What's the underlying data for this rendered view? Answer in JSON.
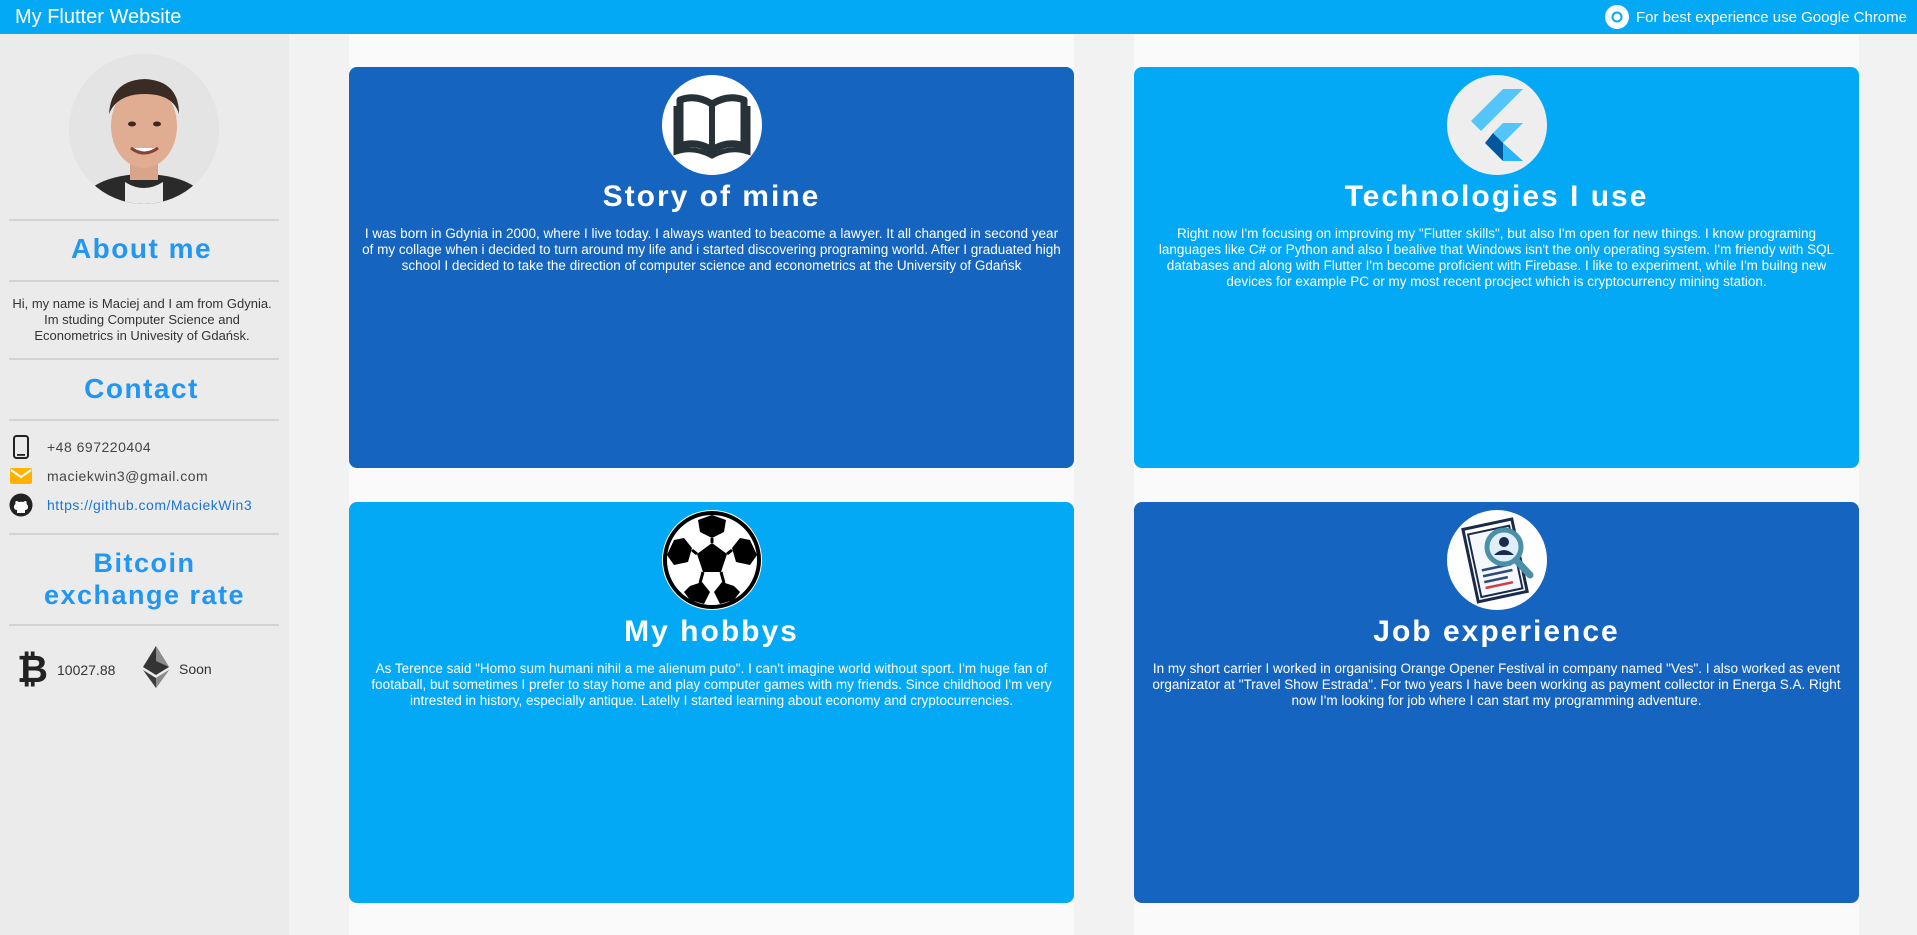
{
  "appbar": {
    "title": "My Flutter Website",
    "browser_hint": "For best experience use Google Chrome"
  },
  "sidebar": {
    "about_heading": "About me",
    "about_text": "Hi, my name is Maciej and I am from Gdynia. Im studing Computer Science and Econometrics in Univesity of Gdańsk.",
    "contact_heading": "Contact",
    "phone": "+48 697220404",
    "email": "maciekwin3@gmail.com",
    "github": "https://github.com/MaciekWin3",
    "bitcoin_heading_line1": "Bitcoin",
    "bitcoin_heading_line2": "exchange rate",
    "btc_rate": "10027.88",
    "eth_rate": "Soon"
  },
  "cards": {
    "story": {
      "title": "Story of mine",
      "text": "I was born in Gdynia in 2000, where I live today. I always wanted to beacome a lawyer. It all changed in second year of my collage when i decided to turn around my life and i started discovering programing world. After I graduated high school I decided to take the direction of computer science and econometrics at the University of Gdańsk",
      "icon": "book-icon"
    },
    "tech": {
      "title": "Technologies I use",
      "text": "Right now I'm focusing on improving my \"Flutter skills\", but also I'm open for new things. I know programing languages like C# or Python and also I bealive that Windows isn't the only operating system. I'm friendy with SQL databases and along with Flutter I'm become proficient with Firebase. I like to experiment, while I'm builng new devices for example PC or my most recent procject which is cryptocurrency mining station.",
      "icon": "flutter-logo-icon"
    },
    "hobbys": {
      "title": "My hobbys",
      "text": "As Terence said \"Homo sum humani nihil a me alienum puto\". I can't imagine world without sport. I'm huge fan of footaball, but sometimes I prefer to stay home and play computer games with my friends. Since childhood I'm very intrested in history, especially antique. Latelly I started learning about economy and cryptocurrencies.",
      "icon": "soccer-ball-icon"
    },
    "job": {
      "title": "Job experience",
      "text": "In my short carrier I worked in organising Orange Opener Festival in company named \"Ves\". I also worked as event organizator at \"Travel Show Estrada\". For two years I have been working as payment collector in Energa S.A. Right now I'm looking for job where I can start my programming adventure.",
      "icon": "resume-search-icon"
    }
  },
  "colors": {
    "appbar": "#03a9f4",
    "card_dark": "#1565c0",
    "card_light": "#03a9f4",
    "heading_blue": "#2196f3"
  }
}
